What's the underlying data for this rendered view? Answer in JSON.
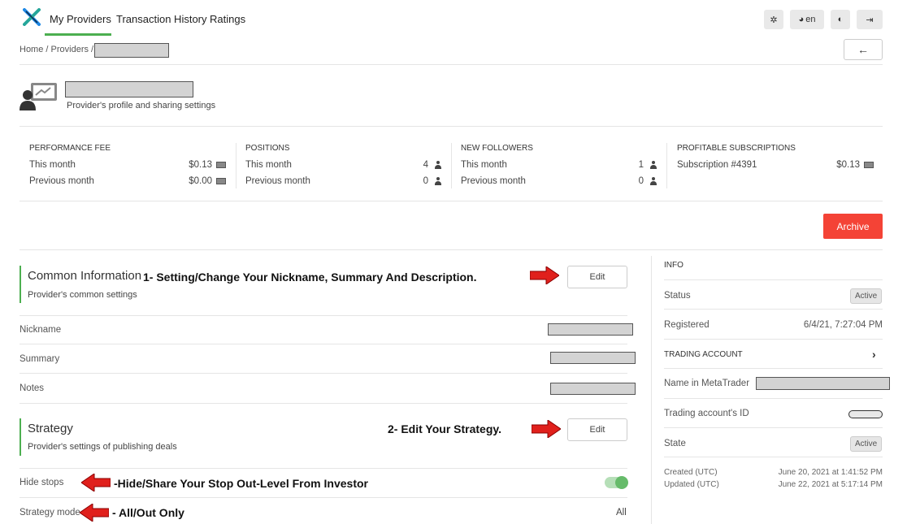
{
  "nav": {
    "tabs": [
      "My Providers",
      "Transaction History",
      "Ratings"
    ],
    "lang": "en"
  },
  "breadcrumb": {
    "home": "Home",
    "providers": "Providers"
  },
  "profile": {
    "subtitle": "Provider's profile and sharing settings"
  },
  "stats": {
    "performance_fee": {
      "title": "PERFORMANCE FEE",
      "this_label": "This month",
      "this_value": "$0.13",
      "prev_label": "Previous month",
      "prev_value": "$0.00"
    },
    "positions": {
      "title": "POSITIONS",
      "this_label": "This month",
      "this_value": "4",
      "prev_label": "Previous month",
      "prev_value": "0"
    },
    "new_followers": {
      "title": "NEW FOLLOWERS",
      "this_label": "This month",
      "this_value": "1",
      "prev_label": "Previous month",
      "prev_value": "0"
    },
    "profitable_subscriptions": {
      "title": "PROFITABLE SUBSCRIPTIONS",
      "item_label": "Subscription #4391",
      "item_value": "$0.13"
    }
  },
  "archive_label": "Archive",
  "common": {
    "title": "Common Information",
    "annotation": "1- Setting/Change Your Nickname, Summary And Description.",
    "subtitle": "Provider's common settings",
    "edit_label": "Edit",
    "rows": [
      "Nickname",
      "Summary",
      "Notes"
    ]
  },
  "strategy": {
    "title": "Strategy",
    "annotation": "2- Edit Your Strategy.",
    "subtitle": "Provider's settings of publishing deals",
    "edit_label": "Edit",
    "hide_stops_label": "Hide stops",
    "hide_stops_annotation": "-Hide/Share Your Stop Out-Level From Investor",
    "hide_stops_on": true,
    "mode_label": "Strategy mode",
    "mode_annotation": "- All/Out Only",
    "mode_value": "All"
  },
  "info": {
    "title": "INFO",
    "status_label": "Status",
    "status_value": "Active",
    "registered_label": "Registered",
    "registered_value": "6/4/21, 7:27:04 PM",
    "trading_account_title": "TRADING ACCOUNT",
    "name_mt_label": "Name in MetaTrader",
    "account_id_label": "Trading account's ID",
    "state_label": "State",
    "state_value": "Active",
    "created_label": "Created (UTC)",
    "created_value": "June 20, 2021 at 1:41:52 PM",
    "updated_label": "Updated (UTC)",
    "updated_value": "June 22, 2021 at 5:17:14 PM"
  },
  "colors": {
    "accent": "#4caf50",
    "danger": "#f44336",
    "annotation_arrow": "#e0201c"
  }
}
